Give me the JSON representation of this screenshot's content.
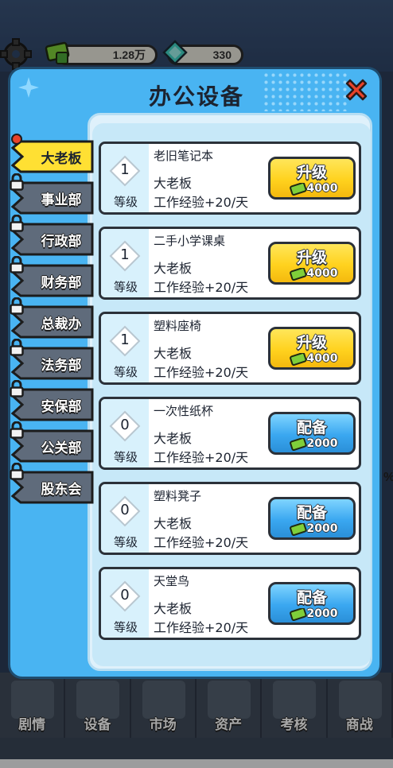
{
  "hud": {
    "cash": "1.28万",
    "gems": "330"
  },
  "modal": {
    "title": "办公设备"
  },
  "tabs": [
    {
      "label": "大老板",
      "active": true,
      "locked": false,
      "notify": true
    },
    {
      "label": "事业部",
      "active": false,
      "locked": true
    },
    {
      "label": "行政部",
      "active": false,
      "locked": true
    },
    {
      "label": "财务部",
      "active": false,
      "locked": true
    },
    {
      "label": "总裁办",
      "active": false,
      "locked": true
    },
    {
      "label": "法务部",
      "active": false,
      "locked": true
    },
    {
      "label": "安保部",
      "active": false,
      "locked": true
    },
    {
      "label": "公关部",
      "active": false,
      "locked": true
    },
    {
      "label": "股东会",
      "active": false,
      "locked": true
    }
  ],
  "items": [
    {
      "name": "老旧笔记本",
      "level": "1",
      "level_label": "等级",
      "owner": "大老板",
      "exp": "工作经验+20/天",
      "action": "升级",
      "cost": "4000",
      "style": "gold"
    },
    {
      "name": "二手小学课桌",
      "level": "1",
      "level_label": "等级",
      "owner": "大老板",
      "exp": "工作经验+20/天",
      "action": "升级",
      "cost": "4000",
      "style": "gold"
    },
    {
      "name": "塑料座椅",
      "level": "1",
      "level_label": "等级",
      "owner": "大老板",
      "exp": "工作经验+20/天",
      "action": "升级",
      "cost": "4000",
      "style": "gold"
    },
    {
      "name": "一次性纸杯",
      "level": "0",
      "level_label": "等级",
      "owner": "大老板",
      "exp": "工作经验+20/天",
      "action": "配备",
      "cost": "2000",
      "style": "blue"
    },
    {
      "name": "塑料凳子",
      "level": "0",
      "level_label": "等级",
      "owner": "大老板",
      "exp": "工作经验+20/天",
      "action": "配备",
      "cost": "2000",
      "style": "blue"
    },
    {
      "name": "天堂鸟",
      "level": "0",
      "level_label": "等级",
      "owner": "大老板",
      "exp": "工作经验+20/天",
      "action": "配备",
      "cost": "2000",
      "style": "blue"
    }
  ],
  "bottom_nav": [
    {
      "label": "剧情"
    },
    {
      "label": "设备"
    },
    {
      "label": "市场"
    },
    {
      "label": "资产"
    },
    {
      "label": "考核"
    },
    {
      "label": "商战"
    }
  ],
  "edge_text": "%",
  "colors": {
    "modal_bg": "#49b4f2",
    "gold_button": "#ffd21e",
    "blue_button": "#3aa7f0",
    "close_red": "#e8432a",
    "tab_active": "#ffe033",
    "tab_inactive": "#5f6b7b"
  },
  "icons": [
    "gear-icon",
    "cash-icon",
    "gem-icon",
    "sparkle-icon",
    "close-icon",
    "lock-icon",
    "diamond-icon"
  ]
}
